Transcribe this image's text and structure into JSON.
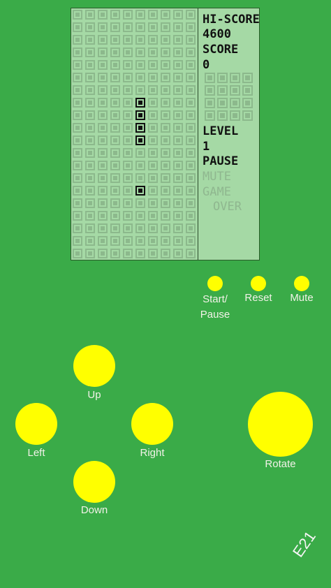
{
  "screen": {
    "hiscore_label": "HI-SCORE",
    "hiscore_value": "4600",
    "score_label": "SCORE",
    "score_value": "0",
    "level_label": "LEVEL",
    "level_value": "1",
    "pause_label": "PAUSE",
    "mute_label": "MUTE",
    "game_label": "GAME",
    "over_label": "OVER"
  },
  "board": {
    "columns": 10,
    "rows": 20,
    "active_cells": [
      [
        5,
        7
      ],
      [
        5,
        8
      ],
      [
        5,
        9
      ],
      [
        5,
        10
      ],
      [
        5,
        14
      ]
    ]
  },
  "preview": {
    "columns": 4,
    "rows": 4
  },
  "controls": {
    "start_pause": "Start/\nPause",
    "reset": "Reset",
    "mute": "Mute",
    "up": "Up",
    "left": "Left",
    "right": "Right",
    "down": "Down",
    "rotate": "Rotate"
  },
  "version": "E21",
  "colors": {
    "background": "#3aab48",
    "button": "#ffff00",
    "screen": "#a5d9a5"
  }
}
